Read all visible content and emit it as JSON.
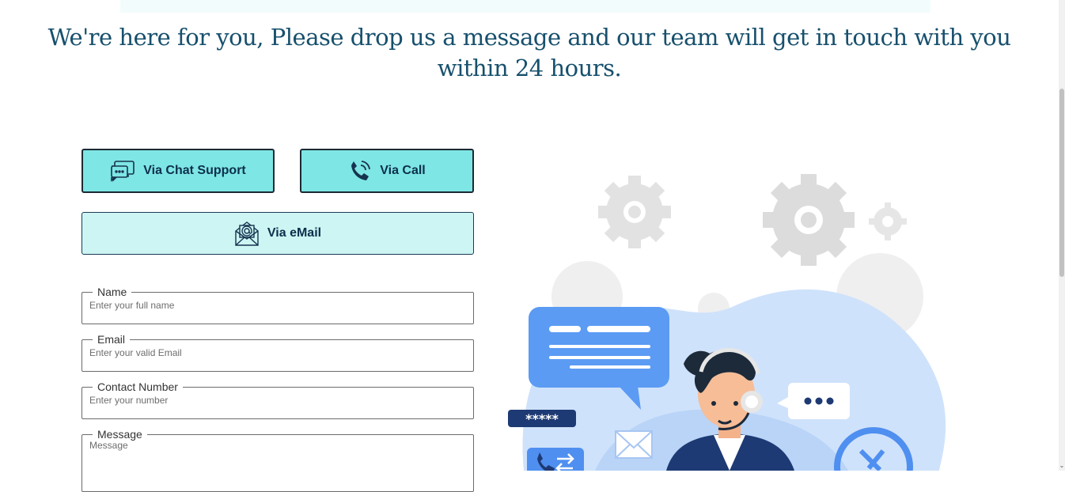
{
  "headline": "We're here for you, Please drop us a message and our team will get in touch with you within 24 hours.",
  "buttons": {
    "chat": "Via Chat Support",
    "call": "Via Call",
    "email": "Via eMail"
  },
  "form": {
    "name": {
      "label": "Name",
      "placeholder": "Enter your full name"
    },
    "email": {
      "label": "Email",
      "placeholder": "Enter your valid Email"
    },
    "phone": {
      "label": "Contact Number",
      "placeholder": "Enter your number"
    },
    "message": {
      "label": "Message",
      "placeholder": "Message"
    }
  },
  "illustration": {
    "password_mask": "*****"
  },
  "icons": [
    "chat-icon",
    "phone-icon",
    "email-icon",
    "chevron-down-icon"
  ],
  "colors": {
    "heading": "#17506d",
    "button_primary": "#7ee6e4",
    "button_secondary": "#cdf5f3",
    "button_text": "#0d2f4c"
  }
}
